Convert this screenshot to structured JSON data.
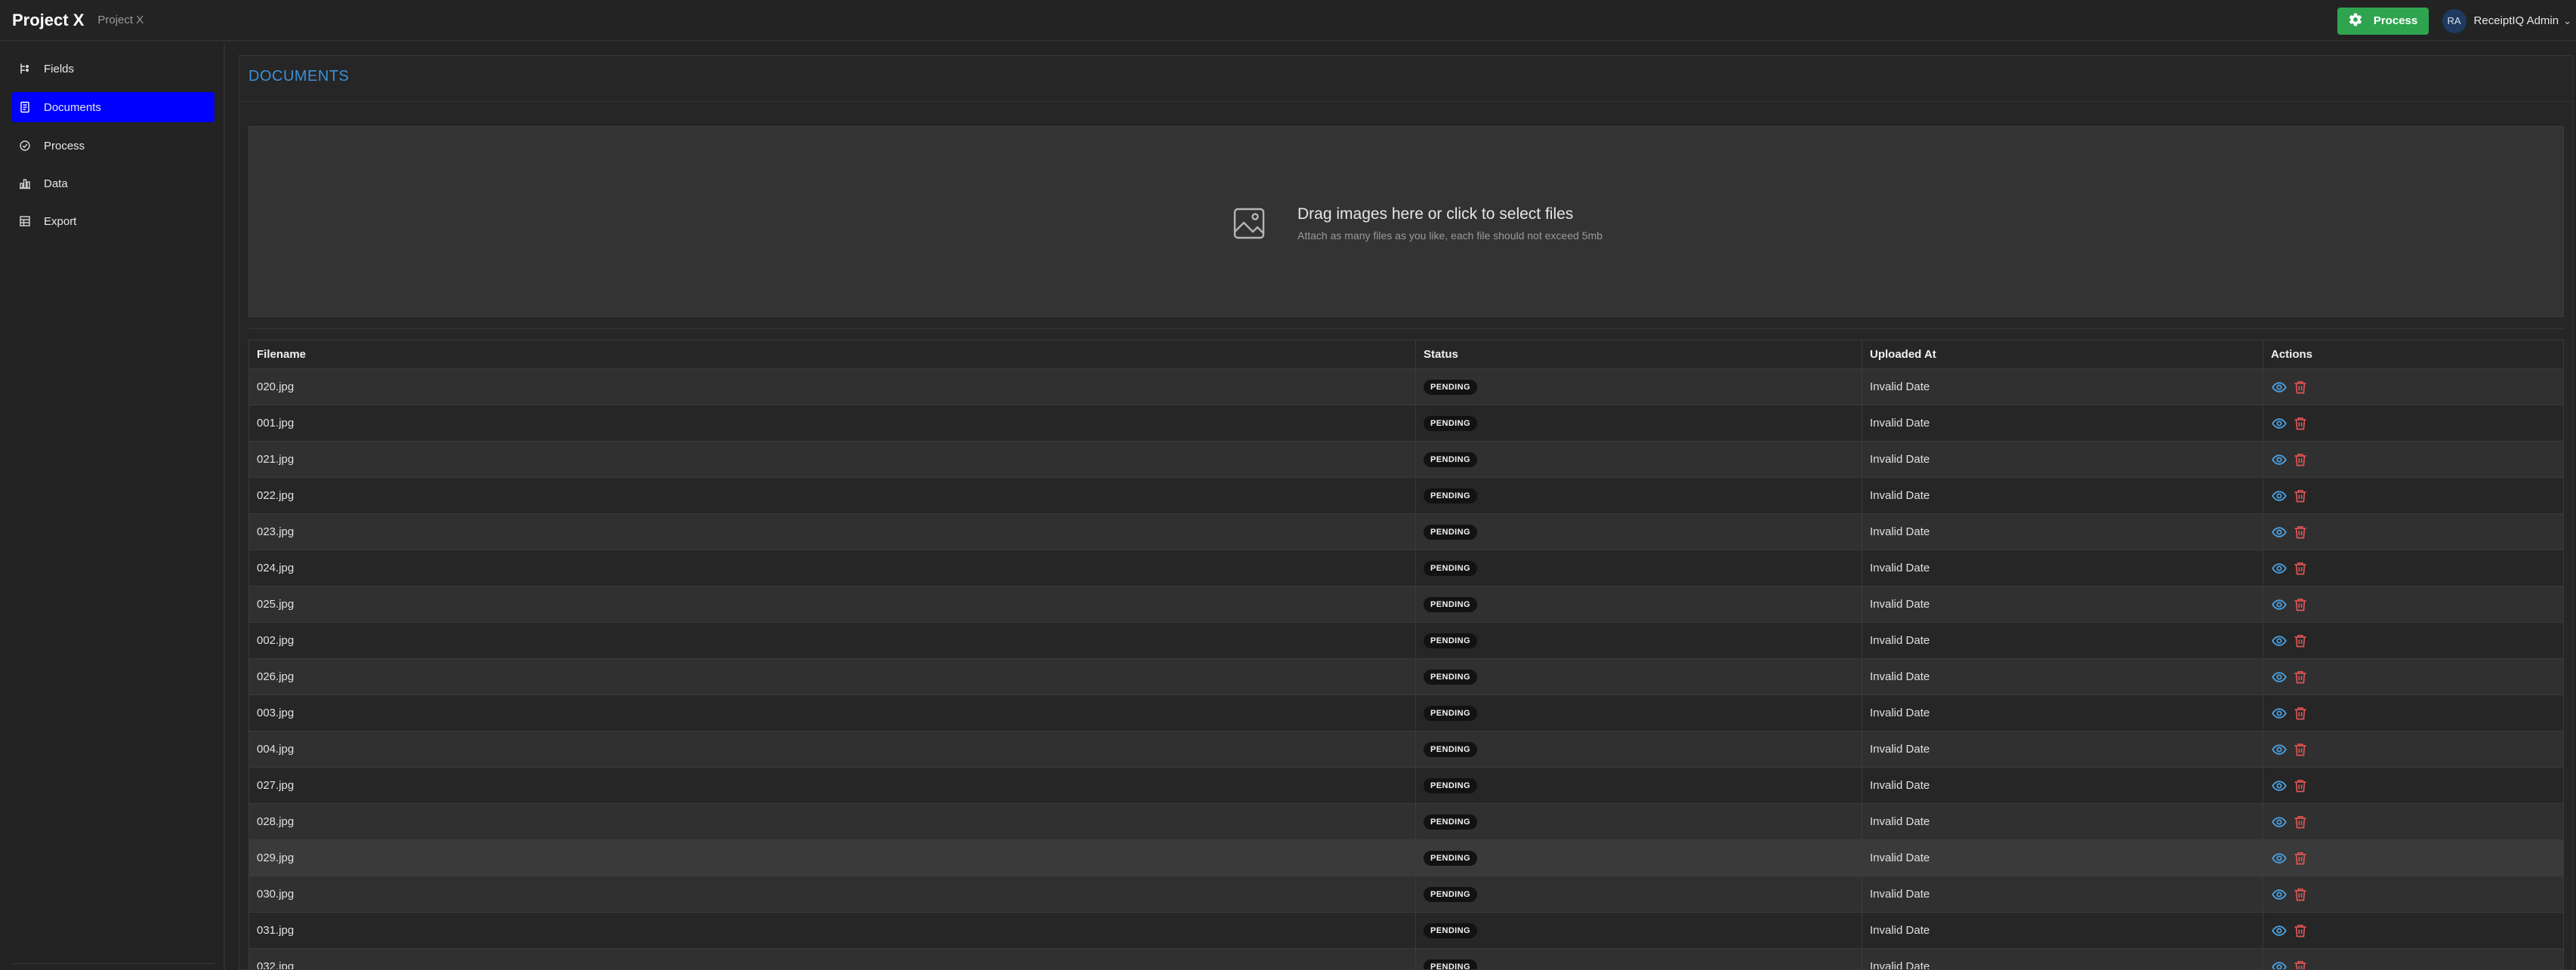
{
  "header": {
    "brand": "Project X",
    "breadcrumb": "Project X",
    "process_label": "Process",
    "user_initials": "RA",
    "user_name": "ReceiptIQ Admin"
  },
  "sidebar": {
    "items": [
      {
        "label": "Fields",
        "icon": "fields-icon"
      },
      {
        "label": "Documents",
        "icon": "document-icon",
        "active": true
      },
      {
        "label": "Process",
        "icon": "process-icon"
      },
      {
        "label": "Data",
        "icon": "bar-chart-icon"
      },
      {
        "label": "Export",
        "icon": "table-icon"
      }
    ]
  },
  "main": {
    "title": "DOCUMENTS",
    "dropzone": {
      "title": "Drag images here or click to select files",
      "subtitle": "Attach as many files as you like, each file should not exceed 5mb"
    },
    "table": {
      "headers": [
        "Filename",
        "Status",
        "Uploaded At",
        "Actions"
      ],
      "rows": [
        {
          "filename": "020.jpg",
          "status": "PENDING",
          "uploaded": "Invalid Date"
        },
        {
          "filename": "001.jpg",
          "status": "PENDING",
          "uploaded": "Invalid Date"
        },
        {
          "filename": "021.jpg",
          "status": "PENDING",
          "uploaded": "Invalid Date"
        },
        {
          "filename": "022.jpg",
          "status": "PENDING",
          "uploaded": "Invalid Date"
        },
        {
          "filename": "023.jpg",
          "status": "PENDING",
          "uploaded": "Invalid Date"
        },
        {
          "filename": "024.jpg",
          "status": "PENDING",
          "uploaded": "Invalid Date"
        },
        {
          "filename": "025.jpg",
          "status": "PENDING",
          "uploaded": "Invalid Date"
        },
        {
          "filename": "002.jpg",
          "status": "PENDING",
          "uploaded": "Invalid Date"
        },
        {
          "filename": "026.jpg",
          "status": "PENDING",
          "uploaded": "Invalid Date"
        },
        {
          "filename": "003.jpg",
          "status": "PENDING",
          "uploaded": "Invalid Date"
        },
        {
          "filename": "004.jpg",
          "status": "PENDING",
          "uploaded": "Invalid Date"
        },
        {
          "filename": "027.jpg",
          "status": "PENDING",
          "uploaded": "Invalid Date"
        },
        {
          "filename": "028.jpg",
          "status": "PENDING",
          "uploaded": "Invalid Date"
        },
        {
          "filename": "029.jpg",
          "status": "PENDING",
          "uploaded": "Invalid Date"
        },
        {
          "filename": "030.jpg",
          "status": "PENDING",
          "uploaded": "Invalid Date"
        },
        {
          "filename": "031.jpg",
          "status": "PENDING",
          "uploaded": "Invalid Date"
        },
        {
          "filename": "032.jpg",
          "status": "PENDING",
          "uploaded": "Invalid Date"
        }
      ]
    }
  },
  "colors": {
    "accent": "#0000ff",
    "process_button": "#2ea44f",
    "title": "#3d8fd6",
    "view_icon": "#4a9fe0",
    "delete_icon": "#e05555"
  }
}
